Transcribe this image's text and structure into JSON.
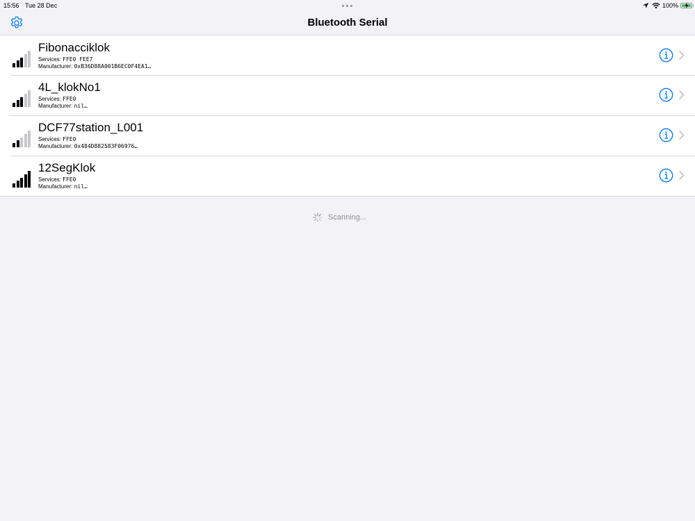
{
  "status_bar": {
    "time": "15:56",
    "date": "Tue 28 Dec",
    "battery_percent": "100%",
    "icons": [
      "location-arrow-icon",
      "wifi-icon",
      "battery-charging-icon"
    ]
  },
  "nav": {
    "title": "Bluetooth Serial",
    "settings_icon": "gear-icon"
  },
  "colors": {
    "accent": "#007aff",
    "signal_active": "#000000",
    "signal_inactive": "#c7c7cc",
    "battery": "#34c759"
  },
  "devices": [
    {
      "name": "Fibonacciklok",
      "services_label": "Services:",
      "services": "FFE0 FEE7",
      "manufacturer_label": "Manufacturer:",
      "manufacturer": "0xB36D88A001B6EC0F4EA1…",
      "signal_level": 3,
      "signal_max": 5
    },
    {
      "name": "4L_klokNo1",
      "services_label": "Services:",
      "services": "FFE0",
      "manufacturer_label": "Manufacturer:",
      "manufacturer": "nil…",
      "signal_level": 3,
      "signal_max": 5
    },
    {
      "name": "DCF77station_L001",
      "services_label": "Services:",
      "services": "FFE0",
      "manufacturer_label": "Manufacturer:",
      "manufacturer": "0x484D882583F06976…",
      "signal_level": 2,
      "signal_max": 5
    },
    {
      "name": "12SegKlok",
      "services_label": "Services:",
      "services": "FFE0",
      "manufacturer_label": "Manufacturer:",
      "manufacturer": "nil…",
      "signal_level": 5,
      "signal_max": 5
    }
  ],
  "scanning": {
    "label": "Scanning...",
    "icon": "spinner-icon"
  }
}
